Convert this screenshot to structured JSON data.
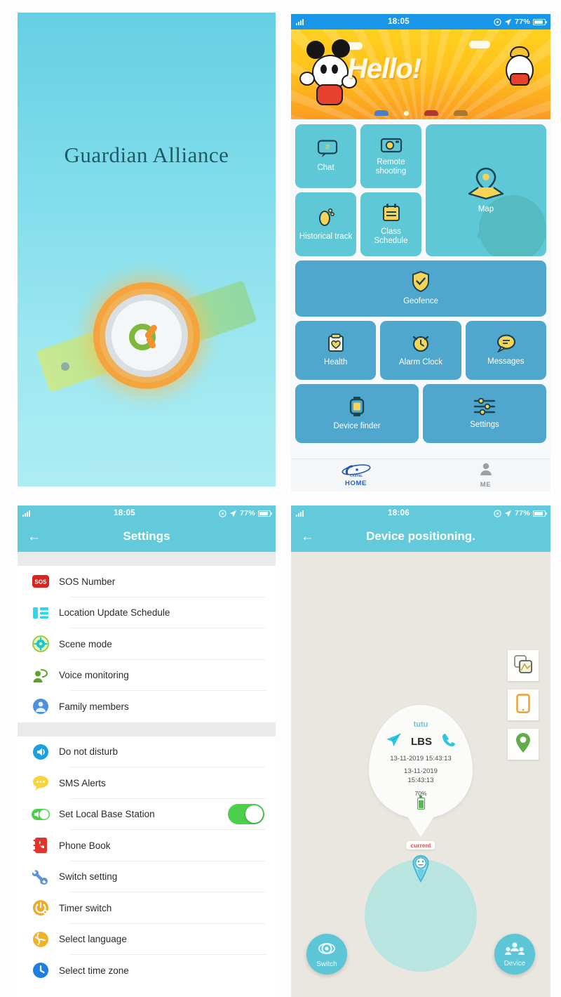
{
  "splash": {
    "app_title": "Guardian Alliance",
    "watch_icon": "smartwatch-tracker-icon"
  },
  "home": {
    "statusbar": {
      "time": "18:05",
      "battery": "77%",
      "signal_icon": "signal-bars-icon",
      "alarm_icon": "alarm-icon",
      "location_icon": "location-arrow-icon",
      "battery_icon": "battery-icon"
    },
    "banner": {
      "greeting": "Hello!",
      "mascot_icon": "cartoon-mascot-icon",
      "plane_icon": "airplane-icon"
    },
    "tiles": [
      {
        "label": "Chat",
        "icon": "chat-bubble-icon",
        "style": "light"
      },
      {
        "label": "Remote shooting",
        "icon": "camera-icon",
        "style": "light"
      },
      {
        "label": "Historical track",
        "icon": "footprint-icon",
        "style": "light"
      },
      {
        "label": "Class Schedule",
        "icon": "calendar-list-icon",
        "style": "light"
      },
      {
        "label": "Map",
        "icon": "map-pin-icon",
        "style": "light"
      },
      {
        "label": "Geofence",
        "icon": "shield-check-icon",
        "style": "dark"
      },
      {
        "label": "Health",
        "icon": "clipboard-heart-icon",
        "style": "dark"
      },
      {
        "label": "Alarm Clock",
        "icon": "alarm-clock-icon",
        "style": "dark"
      },
      {
        "label": "Messages",
        "icon": "message-bubble-icon",
        "style": "dark"
      },
      {
        "label": "Device finder",
        "icon": "smartwatch-icon",
        "style": "dark"
      },
      {
        "label": "Settings",
        "icon": "sliders-icon",
        "style": "dark"
      }
    ],
    "tabs": [
      {
        "label": "HOME",
        "icon": "castel-logo-icon",
        "brand": "CASTEL",
        "active": true
      },
      {
        "label": "ME",
        "icon": "person-icon",
        "active": false
      }
    ]
  },
  "settings": {
    "statusbar": {
      "time": "18:05",
      "battery": "77%"
    },
    "title": "Settings",
    "back_icon": "arrow-left-icon",
    "group1": [
      {
        "label": "SOS Number",
        "icon": "sos-icon"
      },
      {
        "label": "Location Update Schedule",
        "icon": "schedule-list-icon"
      },
      {
        "label": "Scene mode",
        "icon": "gear-circle-icon"
      },
      {
        "label": "Voice monitoring",
        "icon": "voice-person-icon"
      },
      {
        "label": "Family members",
        "icon": "family-group-icon"
      }
    ],
    "group2": [
      {
        "label": "Do not disturb",
        "icon": "speaker-icon",
        "toggle": null
      },
      {
        "label": "SMS Alerts",
        "icon": "sms-bubble-icon",
        "toggle": null
      },
      {
        "label": "Set Local Base Station",
        "icon": "toggle-small-icon",
        "toggle": "on"
      },
      {
        "label": "Phone Book",
        "icon": "phone-book-icon",
        "toggle": null
      },
      {
        "label": "Switch setting",
        "icon": "wrench-icon",
        "toggle": null
      },
      {
        "label": "Timer switch",
        "icon": "timer-power-icon",
        "toggle": null
      },
      {
        "label": "Select language",
        "icon": "globe-icon",
        "toggle": null
      },
      {
        "label": "Select time zone",
        "icon": "clock-icon",
        "toggle": null
      }
    ]
  },
  "map": {
    "statusbar": {
      "time": "18:06",
      "battery": "77%"
    },
    "title": "Device positioning.",
    "back_icon": "arrow-left-icon",
    "side_buttons": [
      {
        "icon": "map-layers-icon"
      },
      {
        "icon": "phone-device-icon"
      },
      {
        "icon": "location-pin-icon"
      }
    ],
    "popup": {
      "device_name": "tutu",
      "location_type": "LBS",
      "timestamp_1": "13-11-2019 15:43:13",
      "timestamp_2_date": "13-11-2019",
      "timestamp_2_time": "15:43:13",
      "battery_percent": "70%",
      "nav_icon": "navigate-icon",
      "call_icon": "phone-call-icon",
      "battery_icon": "battery-vertical-icon"
    },
    "current_marker": {
      "label": "current",
      "icon": "smiley-pin-icon"
    },
    "fabs": [
      {
        "label": "Switch",
        "icon": "switch-circle-icon"
      },
      {
        "label": "Device",
        "icon": "device-group-icon"
      }
    ]
  }
}
